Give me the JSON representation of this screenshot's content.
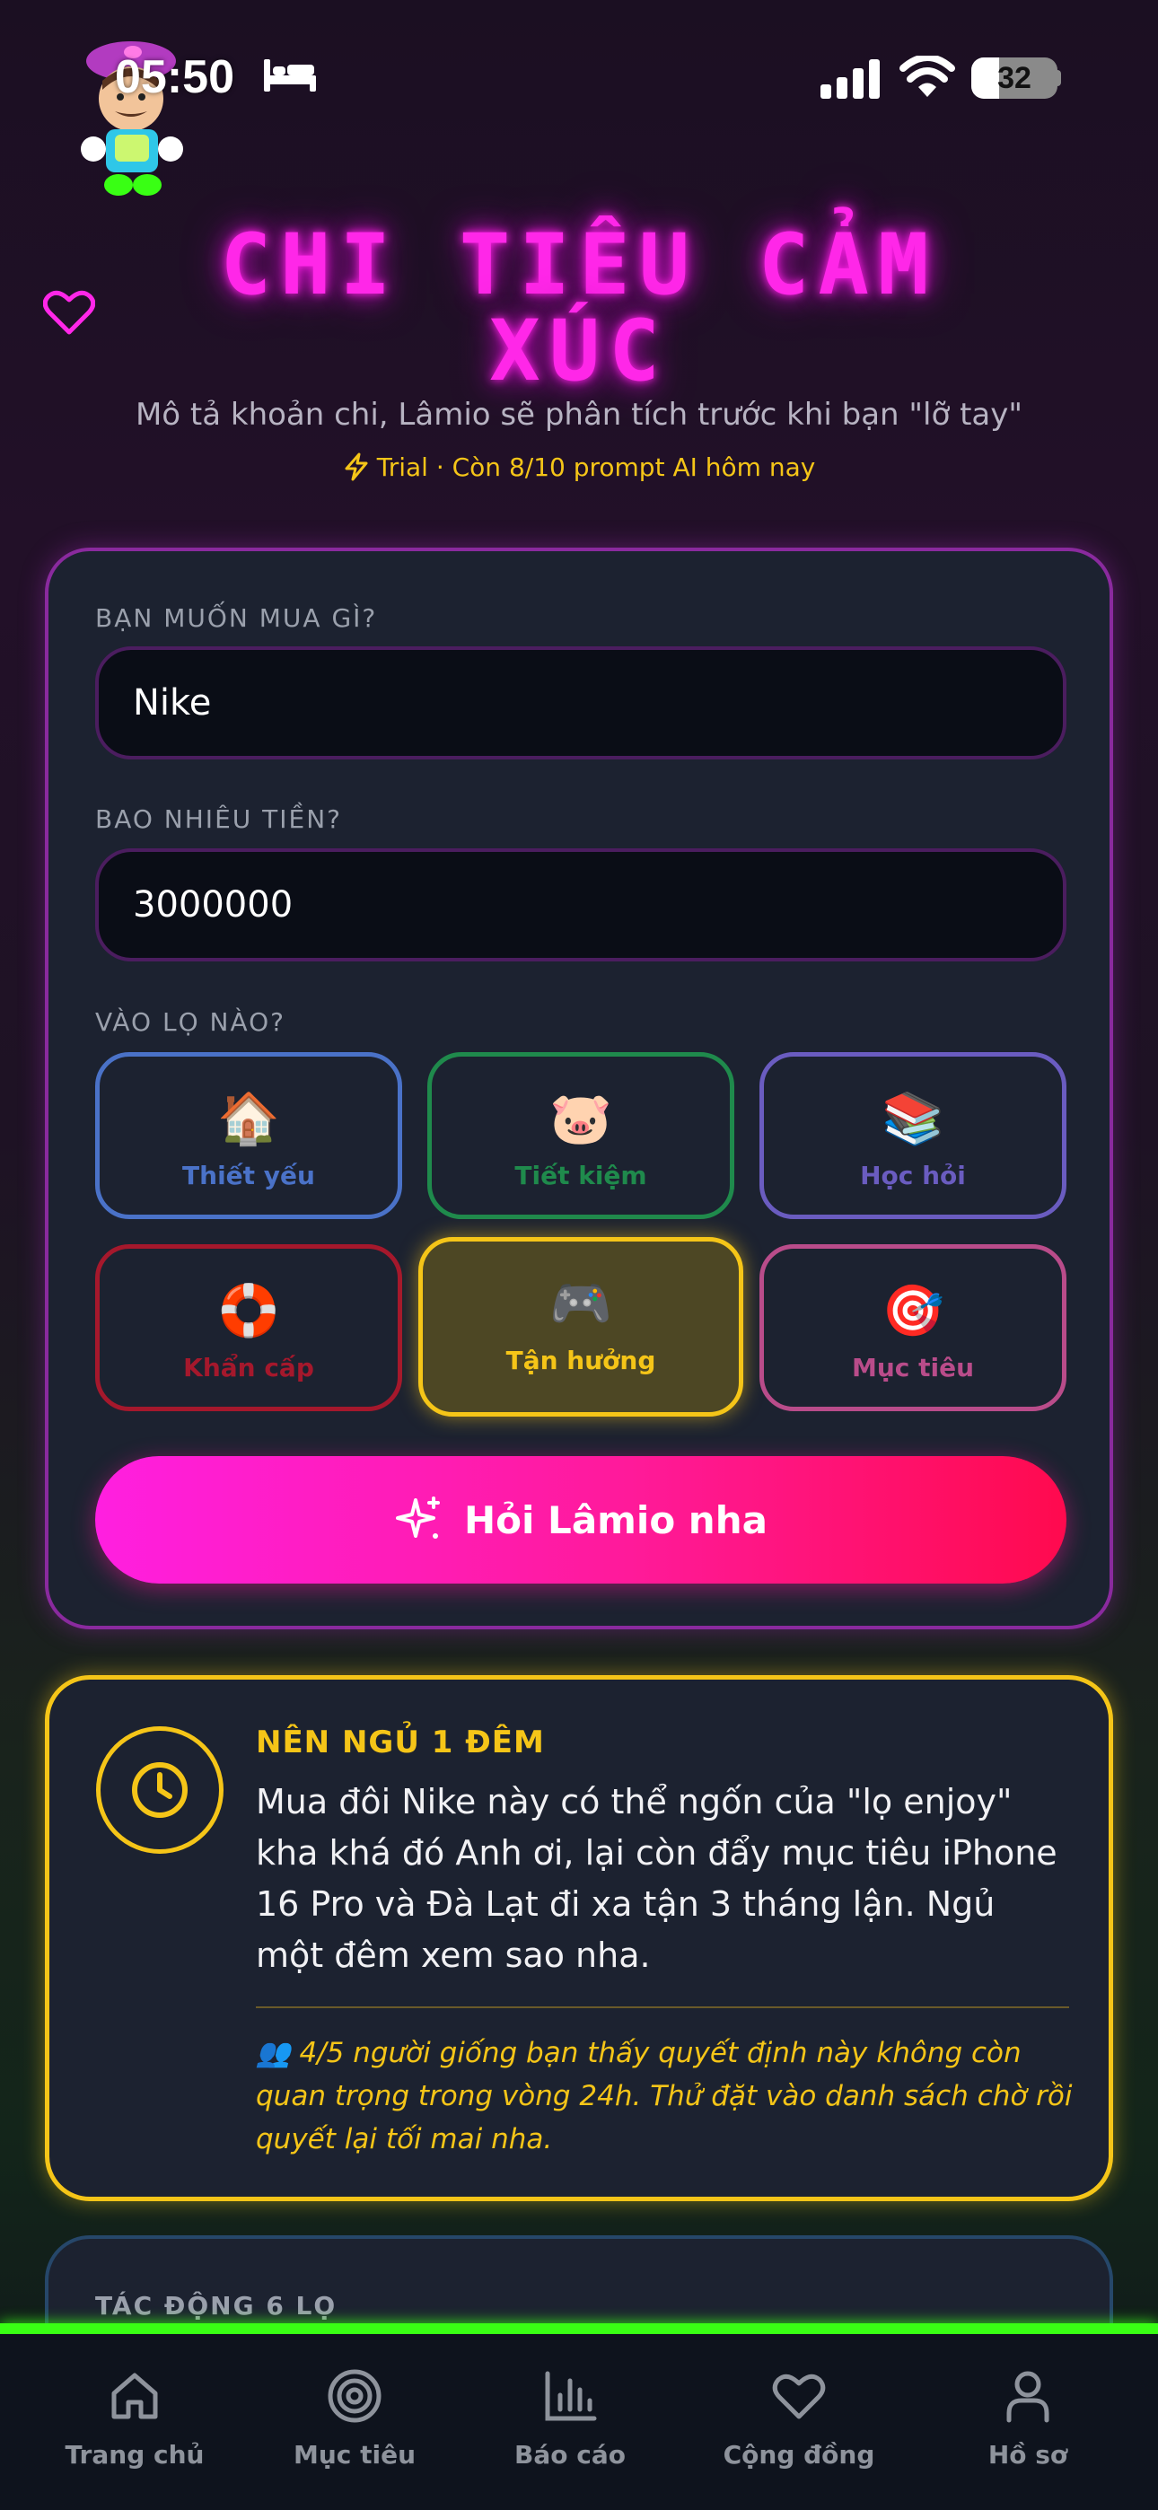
{
  "status_bar": {
    "time": "05:50",
    "battery": "32",
    "battery_level": 0.32
  },
  "header": {
    "title": "CHI TIÊU CẢM XÚC",
    "subtitle": "Mô tả khoản chi, Lâmio sẽ phân tích trước khi bạn \"lỡ tay\"",
    "trial": "Trial · Còn 8/10 prompt AI hôm nay"
  },
  "form": {
    "item_label": "BẠN MUỐN MUA GÌ?",
    "item_value": "Nike",
    "amount_label": "BAO NHIÊU TIỀN?",
    "amount_value": "3000000",
    "jar_label": "VÀO LỌ NÀO?",
    "jars": [
      {
        "emoji": "🏠",
        "label": "Thiết yếu",
        "color": "#4a72c8",
        "selected": false
      },
      {
        "emoji": "🐷",
        "label": "Tiết kiệm",
        "color": "#1f8a4c",
        "selected": false
      },
      {
        "emoji": "📚",
        "label": "Học hỏi",
        "color": "#6a5cc0",
        "selected": false
      },
      {
        "emoji": "🛟",
        "label": "Khẩn cấp",
        "color": "#a5182c",
        "selected": false
      },
      {
        "emoji": "🎮",
        "label": "Tận hưởng",
        "color": "#f5c518",
        "selected": true
      },
      {
        "emoji": "🎯",
        "label": "Mục tiêu",
        "color": "#b94c8a",
        "selected": false
      }
    ],
    "submit_label": "Hỏi Lâmio nha"
  },
  "advice": {
    "verdict": "NÊN NGỦ 1 ĐÊM",
    "text": "Mua đôi Nike này có thể ngốn của \"lọ enjoy\" kha khá đó Anh ơi, lại còn đẩy mục tiêu iPhone 16 Pro và Đà Lạt đi xa tận 3 tháng lận. Ngủ một đêm xem sao nha.",
    "social_proof": "👥 4/5 người giống bạn thấy quyết định này không còn quan trọng trong vòng 24h. Thử đặt vào danh sách chờ rồi quyết lại tối mai nha."
  },
  "impact": {
    "title": "TÁC ĐỘNG 6 LỌ"
  },
  "nav": [
    {
      "icon": "home-icon",
      "label": "Trang chủ"
    },
    {
      "icon": "target-icon",
      "label": "Mục tiêu"
    },
    {
      "icon": "bar-chart-icon",
      "label": "Báo cáo"
    },
    {
      "icon": "heart-icon",
      "label": "Cộng đồng"
    },
    {
      "icon": "user-icon",
      "label": "Hồ sơ"
    }
  ],
  "colors": {
    "neon_pink": "#ff27e8",
    "accent_yellow": "#f5c518",
    "nav_glow": "#39ff14",
    "card_bg": "#1c2230"
  }
}
